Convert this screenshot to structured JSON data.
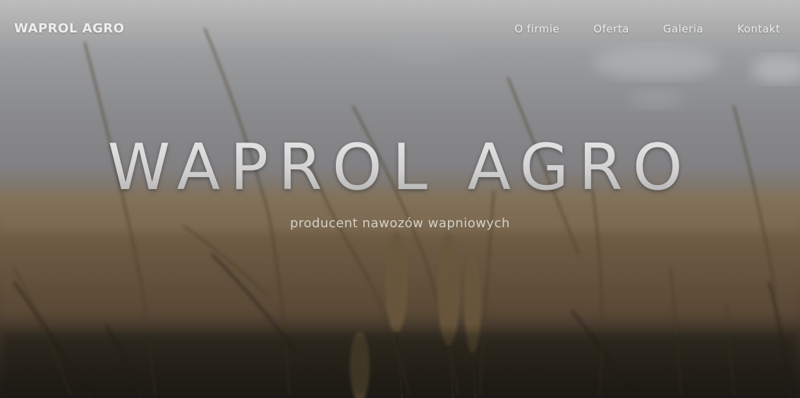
{
  "header": {
    "logo": "WAPROL AGRO",
    "nav": [
      {
        "label": "O firmie"
      },
      {
        "label": "Oferta"
      },
      {
        "label": "Galeria"
      },
      {
        "label": "Kontakt"
      }
    ]
  },
  "hero": {
    "title": "WAPROL AGRO",
    "subtitle": "producent nawozów wapniowych"
  }
}
